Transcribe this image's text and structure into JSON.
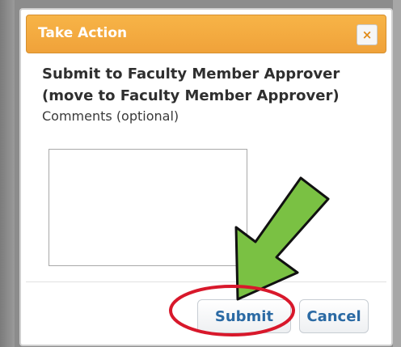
{
  "dialog": {
    "title": "Take Action",
    "close_glyph": "×",
    "heading": "Submit to Faculty Member Approver (move to Faculty Member Approver)",
    "comments_label": "Comments (optional)",
    "comments_value": "",
    "submit_label": "Submit",
    "cancel_label": "Cancel"
  },
  "annotations": {
    "arrow_color": "#7ac143",
    "circle_color": "#d8182b"
  }
}
